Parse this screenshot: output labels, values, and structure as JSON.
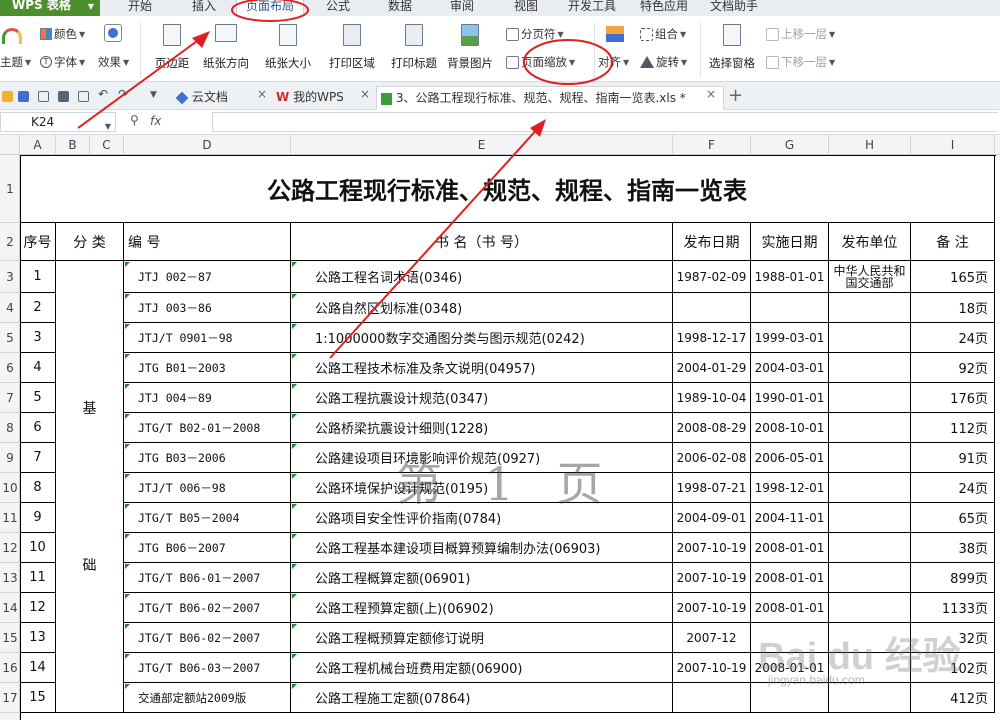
{
  "app": {
    "name": "WPS 表格"
  },
  "menu": [
    "开始",
    "插入",
    "页面布局",
    "公式",
    "数据",
    "审阅",
    "视图",
    "开发工具",
    "特色应用",
    "文档助手"
  ],
  "ribbon": {
    "colors": "颜色",
    "theme": "主题",
    "font": "字体",
    "effects": "效果",
    "margins": "页边距",
    "orientation": "纸张方向",
    "size": "纸张大小",
    "print_area": "打印区域",
    "print_titles": "打印标题",
    "background": "背景图片",
    "page_break": "分页符",
    "page_zoom": "页面缩放",
    "align": "对齐",
    "group": "组合",
    "rotate": "旋转",
    "selection_pane": "选择窗格",
    "bring_forward": "上移一层",
    "send_backward": "下移一层"
  },
  "tabs": [
    {
      "label": "云文档",
      "active": false
    },
    {
      "label": "我的WPS",
      "active": false
    },
    {
      "label": "3、公路工程现行标准、规范、规程、指南一览表.xls *",
      "active": true
    }
  ],
  "formula_bar": {
    "cell_ref": "K24",
    "fx": "fx",
    "value": ""
  },
  "columns": [
    "A",
    "B",
    "C",
    "D",
    "E",
    "F",
    "G",
    "H",
    "I"
  ],
  "rows": [
    "1",
    "2",
    "3",
    "4",
    "5",
    "6",
    "7",
    "8",
    "9",
    "10",
    "11",
    "12",
    "13",
    "14",
    "15",
    "16",
    "17"
  ],
  "sheet": {
    "title": "公路工程现行标准、规范、规程、指南一览表",
    "headers": {
      "seq": "序号",
      "category": "分 类",
      "code": "编     号",
      "book": "书                    名（书  号）",
      "publish": "发布日期",
      "effective": "实施日期",
      "unit": "发布单位",
      "note": "备  注"
    },
    "category_chars": [
      "基",
      "础"
    ],
    "rows": [
      {
        "seq": "1",
        "code": "JTJ 002－87",
        "name": "公路工程名词术语(0346)",
        "publish": "1987-02-09",
        "effective": "1988-01-01",
        "unit": "中华人民共和国交通部",
        "note": "165页"
      },
      {
        "seq": "2",
        "code": "JTJ 003－86",
        "name": "公路自然区划标准(0348)",
        "publish": "",
        "effective": "",
        "unit": "",
        "note": "18页"
      },
      {
        "seq": "3",
        "code": "JTJ/T 0901－98",
        "name": "1:1000000数字交通图分类与图示规范(0242)",
        "publish": "1998-12-17",
        "effective": "1999-03-01",
        "unit": "",
        "note": "24页"
      },
      {
        "seq": "4",
        "code": "JTG B01－2003",
        "name": "公路工程技术标准及条文说明(04957)",
        "publish": "2004-01-29",
        "effective": "2004-03-01",
        "unit": "",
        "note": "92页"
      },
      {
        "seq": "5",
        "code": "JTJ 004－89",
        "name": "公路工程抗震设计规范(0347)",
        "publish": "1989-10-04",
        "effective": "1990-01-01",
        "unit": "",
        "note": "176页"
      },
      {
        "seq": "6",
        "code": "JTG/T B02-01－2008",
        "name": "公路桥梁抗震设计细则(1228)",
        "publish": "2008-08-29",
        "effective": "2008-10-01",
        "unit": "",
        "note": "112页"
      },
      {
        "seq": "7",
        "code": "JTG B03－2006",
        "name": "公路建设项目环境影响评价规范(0927)",
        "publish": "2006-02-08",
        "effective": "2006-05-01",
        "unit": "",
        "note": "91页"
      },
      {
        "seq": "8",
        "code": "JTJ/T 006－98",
        "name": "公路环境保护设计规范(0195)",
        "publish": "1998-07-21",
        "effective": "1998-12-01",
        "unit": "",
        "note": "24页"
      },
      {
        "seq": "9",
        "code": "JTG/T B05－2004",
        "name": "公路项目安全性评价指南(0784)",
        "publish": "2004-09-01",
        "effective": "2004-11-01",
        "unit": "",
        "note": "65页"
      },
      {
        "seq": "10",
        "code": "JTG B06－2007",
        "name": "公路工程基本建设项目概算预算编制办法(06903)",
        "publish": "2007-10-19",
        "effective": "2008-01-01",
        "unit": "",
        "note": "38页"
      },
      {
        "seq": "11",
        "code": "JTG/T B06-01－2007",
        "name": "公路工程概算定额(06901)",
        "publish": "2007-10-19",
        "effective": "2008-01-01",
        "unit": "",
        "note": "899页"
      },
      {
        "seq": "12",
        "code": "JTG/T B06-02－2007",
        "name": "公路工程预算定额(上)(06902)",
        "publish": "2007-10-19",
        "effective": "2008-01-01",
        "unit": "",
        "note": "1133页"
      },
      {
        "seq": "13",
        "code": "JTG/T B06-02－2007",
        "name": "公路工程概预算定额修订说明",
        "publish": "2007-12",
        "effective": "",
        "unit": "",
        "note": "32页"
      },
      {
        "seq": "14",
        "code": "JTG/T B06-03－2007",
        "name": "公路工程机械台班费用定额(06900)",
        "publish": "2007-10-19",
        "effective": "2008-01-01",
        "unit": "",
        "note": "102页"
      },
      {
        "seq": "15",
        "code": "交通部定额站2009版",
        "name": "公路工程施工定额(07864)",
        "publish": "",
        "effective": "",
        "unit": "",
        "note": "412页"
      }
    ],
    "watermark": "第 1 页"
  },
  "annotation_color": "#e02020",
  "baidu_logo": "Bai du 经验",
  "baidu_url": "jingyan.baidu.com"
}
